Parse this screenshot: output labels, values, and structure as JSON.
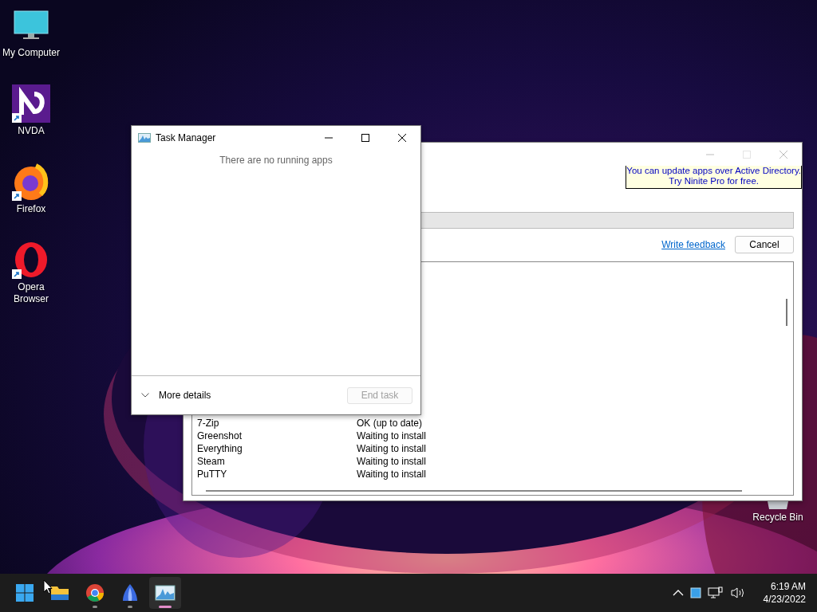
{
  "desktop_icons": [
    {
      "label": "My Computer",
      "kind": "computer",
      "shortcut": false
    },
    {
      "label": "NVDA",
      "kind": "nvda",
      "shortcut": true
    },
    {
      "label": "Firefox",
      "kind": "firefox",
      "shortcut": true
    },
    {
      "label": "Opera Browser",
      "kind": "opera",
      "shortcut": true
    }
  ],
  "recycle_bin": {
    "label": "Recycle Bin"
  },
  "ninite": {
    "tooltip": [
      "You can update apps over Active Directory.",
      "Try Ninite Pro for free."
    ],
    "feedback_link": "Write feedback",
    "cancel_button": "Cancel",
    "apps": [
      {
        "name": "7-Zip",
        "status": "OK (up to date)"
      },
      {
        "name": "Greenshot",
        "status": "Waiting to install"
      },
      {
        "name": "Everything",
        "status": "Waiting to install"
      },
      {
        "name": "Steam",
        "status": "Waiting to install"
      },
      {
        "name": "PuTTY",
        "status": "Waiting to install"
      }
    ]
  },
  "task_manager": {
    "title": "Task Manager",
    "message": "There are no running apps",
    "more_details": "More details",
    "end_task": {
      "label": "End task",
      "disabled": true
    }
  },
  "taskbar": {
    "apps": [
      {
        "kind": "start",
        "running": false,
        "active": false
      },
      {
        "kind": "explorer",
        "running": false,
        "active": false
      },
      {
        "kind": "chrome",
        "running": true,
        "active": false
      },
      {
        "kind": "sail",
        "running": true,
        "active": false
      },
      {
        "kind": "taskmanager",
        "running": true,
        "active": true
      }
    ],
    "time": "6:19 AM",
    "date": "4/23/2022"
  }
}
